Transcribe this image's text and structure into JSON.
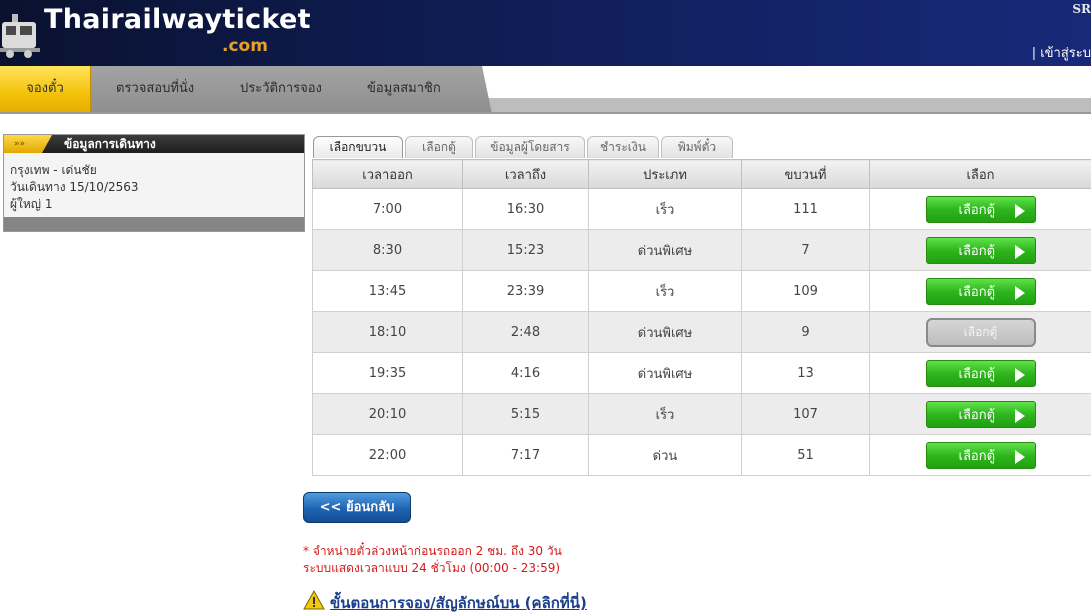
{
  "header": {
    "logo_main": "Thairailwayticket",
    "logo_sub": ".com",
    "corner_text": "SR",
    "login_text": "| เข้าสู่ระบ"
  },
  "nav": {
    "tabs": [
      {
        "label": "จองตั๋ว",
        "active": true
      },
      {
        "label": "ตรวจสอบที่นั่ง",
        "active": false
      },
      {
        "label": "ประวัติการจอง",
        "active": false
      },
      {
        "label": "ข้อมูลสมาชิก",
        "active": false
      }
    ]
  },
  "sidebar": {
    "title": "ข้อมูลการเดินทาง",
    "arrow": "»»",
    "route": "กรุงเทพ - เด่นชัย",
    "date": "วันเดินทาง 15/10/2563",
    "passengers": "ผู้ใหญ่ 1"
  },
  "steps": [
    {
      "label": "เลือกขบวน",
      "active": true
    },
    {
      "label": "เลือกตู้",
      "active": false
    },
    {
      "label": "ข้อมูลผู้โดยสาร",
      "active": false
    },
    {
      "label": "ชำระเงิน",
      "active": false
    },
    {
      "label": "พิมพ์ตั๋ว",
      "active": false
    }
  ],
  "table": {
    "headers": [
      "เวลาออก",
      "เวลาถึง",
      "ประเภท",
      "ขบวนที่",
      "เลือก"
    ],
    "button_label": "เลือกตู้",
    "rows": [
      {
        "depart": "7:00",
        "arrive": "16:30",
        "type": "เร็ว",
        "train": "111",
        "available": true
      },
      {
        "depart": "8:30",
        "arrive": "15:23",
        "type": "ด่วนพิเศษ",
        "train": "7",
        "available": true
      },
      {
        "depart": "13:45",
        "arrive": "23:39",
        "type": "เร็ว",
        "train": "109",
        "available": true
      },
      {
        "depart": "18:10",
        "arrive": "2:48",
        "type": "ด่วนพิเศษ",
        "train": "9",
        "available": false
      },
      {
        "depart": "19:35",
        "arrive": "4:16",
        "type": "ด่วนพิเศษ",
        "train": "13",
        "available": true
      },
      {
        "depart": "20:10",
        "arrive": "5:15",
        "type": "เร็ว",
        "train": "107",
        "available": true
      },
      {
        "depart": "22:00",
        "arrive": "7:17",
        "type": "ด่วน",
        "train": "51",
        "available": true
      }
    ]
  },
  "back_label": "<< ย้อนกลับ",
  "notes": [
    "* จำหน่ายตั๋วล่วงหน้าก่อนรถออก 2 ชม. ถึง 30 วัน",
    "ระบบแสดงเวลาแบบ 24 ชั่วโมง (00:00 - 23:59)"
  ],
  "help_link": "ขั้นตอนการจอง/สัญลักษณ์บน (คลิกที่นี่)",
  "colors": {
    "accent": "#f4c20a",
    "button_green": "#2fb51d",
    "note_red": "#d31a1a",
    "back_blue": "#1f64b3"
  }
}
